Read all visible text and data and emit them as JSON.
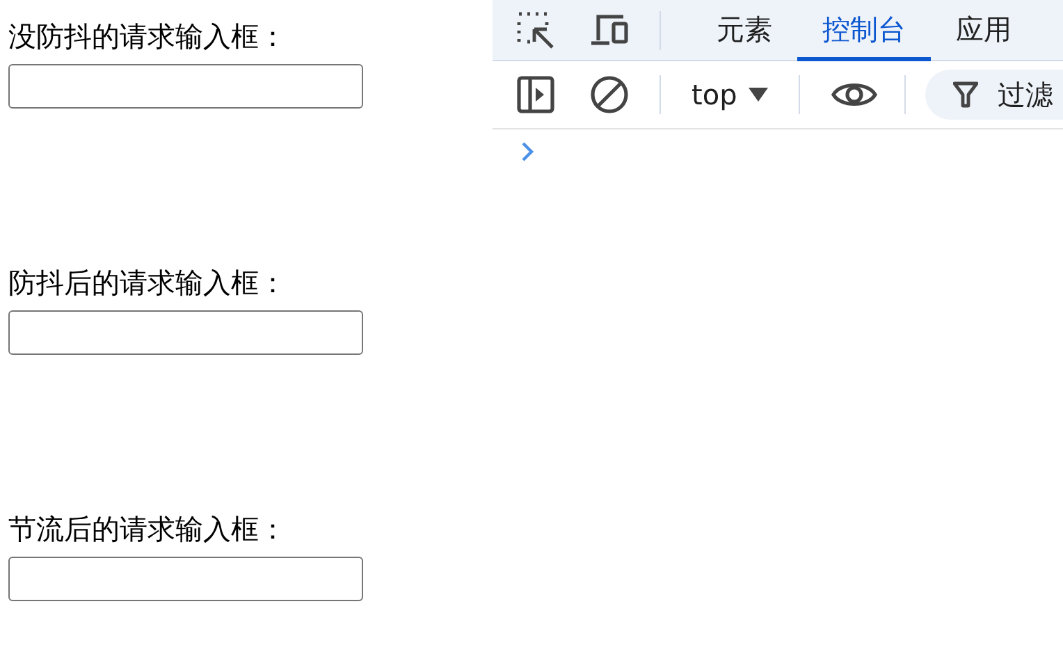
{
  "fields": [
    {
      "label": "没防抖的请求输入框："
    },
    {
      "label": "防抖后的请求输入框："
    },
    {
      "label": "节流后的请求输入框："
    }
  ],
  "devtools": {
    "tabs": [
      {
        "label": "元素",
        "selected": false
      },
      {
        "label": "控制台",
        "selected": true
      },
      {
        "label": "应用",
        "selected": false
      }
    ],
    "context": "top",
    "filter": {
      "placeholder": "过滤"
    }
  }
}
